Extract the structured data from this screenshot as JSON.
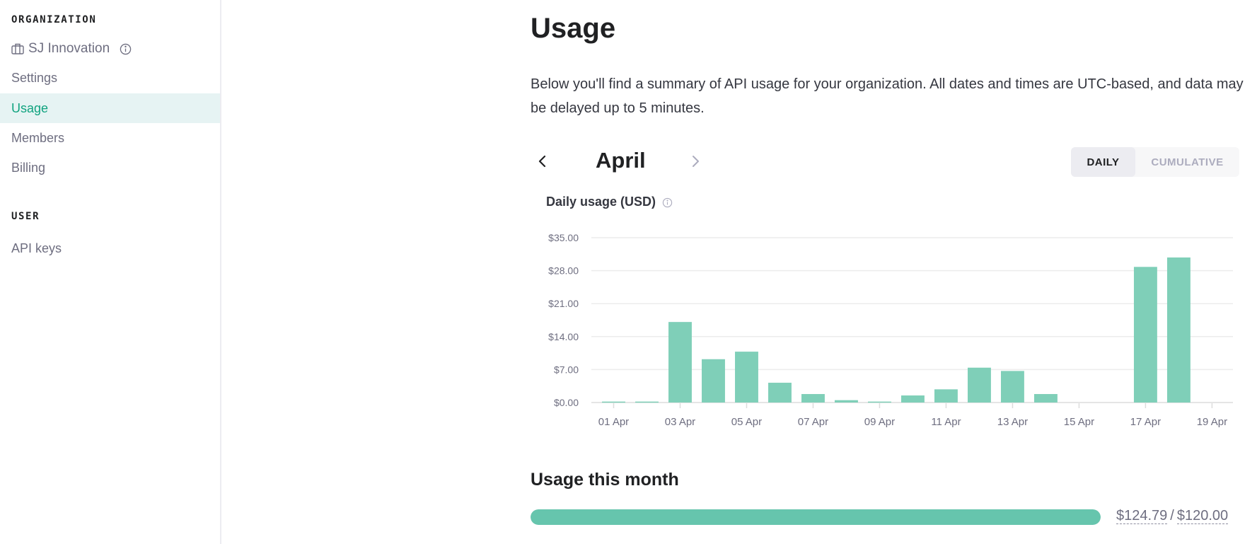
{
  "sidebar": {
    "organization_heading": "ORGANIZATION",
    "org_name": "SJ Innovation",
    "org_icon": "building-icon",
    "org_info_icon": "info-icon",
    "items": [
      {
        "label": "Settings",
        "active": false
      },
      {
        "label": "Usage",
        "active": true
      },
      {
        "label": "Members",
        "active": false
      },
      {
        "label": "Billing",
        "active": false
      }
    ],
    "user_heading": "USER",
    "user_items": [
      {
        "label": "API keys",
        "active": false
      }
    ]
  },
  "main": {
    "title": "Usage",
    "description": "Below you'll find a summary of API usage for your organization. All dates and times are UTC-based, and data may be delayed up to 5 minutes.",
    "month": "April",
    "prev_icon": "chevron-left-icon",
    "next_icon": "chevron-right-icon",
    "toggle": {
      "daily": "DAILY",
      "cumulative": "CUMULATIVE",
      "selected": "DAILY"
    },
    "chart_title": "Daily usage (USD)",
    "usage_section_title": "Usage this month",
    "usage_amount": "$124.79",
    "usage_separator": "/",
    "usage_limit": "$120.00",
    "usage_progress_fraction": 1.0
  },
  "colors": {
    "accent": "#10a37f",
    "bar": "#7fcfb8",
    "progress": "#66c5ad",
    "active_nav_bg": "#e6f3f3"
  },
  "chart_data": {
    "type": "bar",
    "title": "Daily usage (USD)",
    "xlabel": "",
    "ylabel": "",
    "ylim": [
      0,
      35
    ],
    "yticks": [
      0,
      7,
      14,
      21,
      28,
      35
    ],
    "ytick_labels": [
      "$0.00",
      "$7.00",
      "$14.00",
      "$21.00",
      "$28.00",
      "$35.00"
    ],
    "grid": true,
    "categories": [
      "01 Apr",
      "02 Apr",
      "03 Apr",
      "04 Apr",
      "05 Apr",
      "06 Apr",
      "07 Apr",
      "08 Apr",
      "09 Apr",
      "10 Apr",
      "11 Apr",
      "12 Apr",
      "13 Apr",
      "14 Apr",
      "15 Apr",
      "16 Apr",
      "17 Apr",
      "18 Apr",
      "19 Apr"
    ],
    "xtick_labels": [
      "01 Apr",
      "03 Apr",
      "05 Apr",
      "07 Apr",
      "09 Apr",
      "11 Apr",
      "13 Apr",
      "15 Apr",
      "17 Apr",
      "19 Apr"
    ],
    "values": [
      0.2,
      0.2,
      17.1,
      9.2,
      10.8,
      4.2,
      1.8,
      0.5,
      0.2,
      1.5,
      2.8,
      7.4,
      6.7,
      1.8,
      0,
      0,
      28.8,
      30.8,
      0
    ]
  }
}
